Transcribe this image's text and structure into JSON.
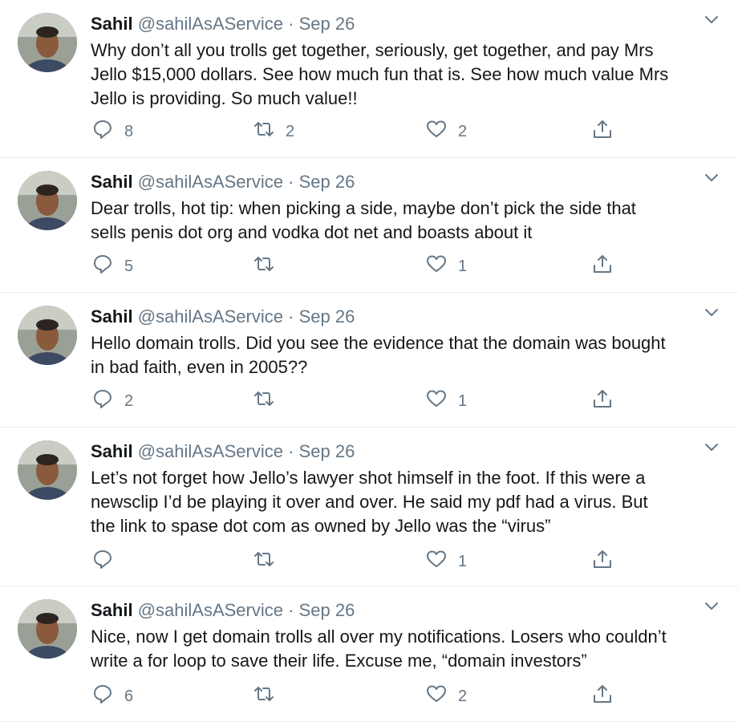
{
  "tweets": [
    {
      "name": "Sahil",
      "handle": "@sahilAsAService",
      "separator": "·",
      "date": "Sep 26",
      "text": "Why don’t all you trolls get together, seriously, get together, and pay Mrs\nJello $15,000 dollars. See how much fun that is. See how much value Mrs\nJello is providing. So much value!!",
      "replies": "8",
      "retweets": "2",
      "likes": "2"
    },
    {
      "name": "Sahil",
      "handle": "@sahilAsAService",
      "separator": "·",
      "date": "Sep 26",
      "text": "Dear trolls, hot tip: when picking a side, maybe don’t pick the side that\nsells penis dot org and vodka dot net and boasts about it",
      "replies": "5",
      "retweets": "",
      "likes": "1"
    },
    {
      "name": "Sahil",
      "handle": "@sahilAsAService",
      "separator": "·",
      "date": "Sep 26",
      "text": "Hello domain trolls. Did you see the evidence that the domain was bought\nin bad faith, even in 2005??",
      "replies": "2",
      "retweets": "",
      "likes": "1"
    },
    {
      "name": "Sahil",
      "handle": "@sahilAsAService",
      "separator": "·",
      "date": "Sep 26",
      "text": "Let’s not forget how Jello’s lawyer shot himself in the foot. If this were a\nnewsclip I’d be playing it over and over. He said my pdf had a virus. But\nthe link to spase dot com as owned by Jello was the “virus”",
      "replies": "",
      "retweets": "",
      "likes": "1"
    },
    {
      "name": "Sahil",
      "handle": "@sahilAsAService",
      "separator": "·",
      "date": "Sep 26",
      "text": "Nice, now I get domain trolls all over my notifications. Losers who couldn’t\nwrite a for loop to save their life. Excuse me, “domain investors”",
      "replies": "6",
      "retweets": "",
      "likes": "2"
    }
  ],
  "icons": {
    "reply": "reply-icon",
    "retweet": "retweet-icon",
    "like": "heart-icon",
    "share": "share-icon",
    "menu": "chevron-down-icon"
  },
  "colors": {
    "text": "#14171a",
    "secondary": "#657786",
    "divider": "#e6ecf0"
  }
}
